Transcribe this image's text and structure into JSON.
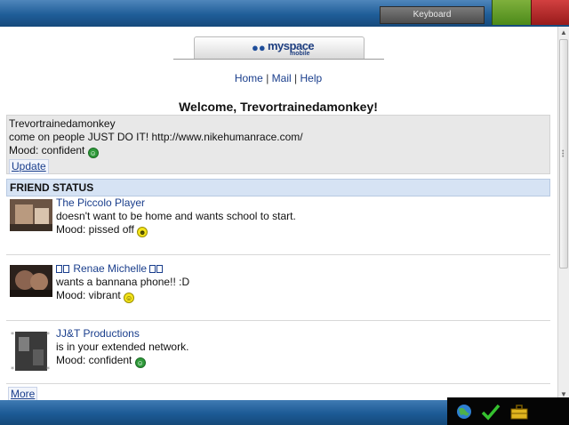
{
  "topbar": {
    "keyboard_label": "Keyboard"
  },
  "logo": {
    "brand": "myspace",
    "sub": "mobile"
  },
  "nav": {
    "home": "Home",
    "sep1": "|",
    "mail": "Mail",
    "sep2": "|",
    "help": "Help"
  },
  "welcome": "Welcome, Trevortrainedamonkey!",
  "status": {
    "username": "Trevortrainedamonkey",
    "message": "come on people JUST DO IT! http://www.nikehumanrace.com/",
    "mood_prefix": "Mood: confident",
    "update_label": "Update"
  },
  "section_title": "FRIEND STATUS",
  "friends": [
    {
      "name": "The Piccolo Player",
      "status": "doesn't want to be home and wants school to start.",
      "mood": "Mood: pissed off"
    },
    {
      "name": "Renae Michelle",
      "status": "wants a bannana phone!! :D",
      "mood": "Mood: vibrant"
    },
    {
      "name": "JJ&T Productions",
      "status": "is in your extended network.",
      "mood": "Mood: confident"
    }
  ],
  "more_label": "More",
  "icons": {
    "logo": "people-icon",
    "mood": "smiley-icon",
    "tray": [
      "globe-icon",
      "checkmark-icon",
      "briefcase-icon"
    ]
  },
  "colors": {
    "link": "#1a3e8c",
    "section_bg": "#d6e3f4",
    "bar_blue": "#1f5d98"
  }
}
